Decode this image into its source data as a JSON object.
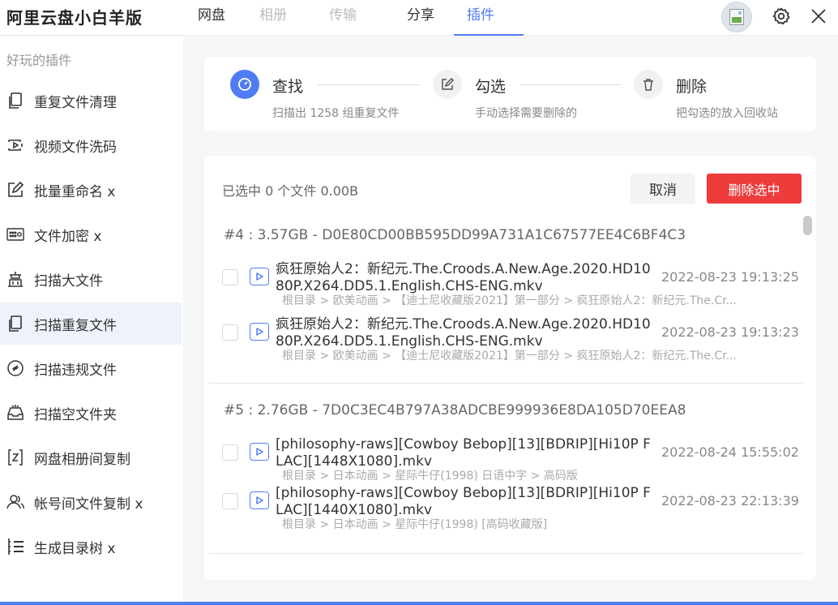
{
  "app": {
    "title": "阿里云盘小白羊版"
  },
  "nav": {
    "tabs": [
      {
        "label": "网盘",
        "state": "normal"
      },
      {
        "label": "相册",
        "state": "dim"
      },
      {
        "label": "传输",
        "state": "dim"
      },
      {
        "label": "分享",
        "state": "normal"
      },
      {
        "label": "插件",
        "state": "active"
      }
    ]
  },
  "sidebar": {
    "heading": "好玩的插件",
    "items": [
      {
        "label": "重复文件清理",
        "icon": "copy-icon"
      },
      {
        "label": "视频文件洗码",
        "icon": "video-icon"
      },
      {
        "label": "批量重命名 x",
        "icon": "edit-icon"
      },
      {
        "label": "文件加密 x",
        "icon": "keypad-icon"
      },
      {
        "label": "扫描大文件",
        "icon": "building-icon"
      },
      {
        "label": "扫描重复文件",
        "icon": "copy-icon",
        "active": true
      },
      {
        "label": "扫描违规文件",
        "icon": "link-icon"
      },
      {
        "label": "扫描空文件夹",
        "icon": "tray-icon"
      },
      {
        "label": "网盘相册间复制",
        "icon": "album-copy-icon"
      },
      {
        "label": "帐号间文件复制 x",
        "icon": "users-icon"
      },
      {
        "label": "生成目录树 x",
        "icon": "tree-icon"
      }
    ]
  },
  "steps": [
    {
      "title": "查找",
      "desc": "扫描出 1258 组重复文件",
      "icon": "timer-icon",
      "active": true
    },
    {
      "title": "勾选",
      "desc": "手动选择需要删除的",
      "icon": "edit-icon",
      "active": false
    },
    {
      "title": "删除",
      "desc": "把勾选的放入回收站",
      "icon": "trash-icon",
      "active": false
    }
  ],
  "list": {
    "selected_info": "已选中 0 个文件 0.00B",
    "cancel_label": "取消",
    "delete_label": "删除选中",
    "groups": [
      {
        "header": "#4 : 3.57GB - D0E80CD00BB595DD99A731A1C67577EE4C6BF4C3",
        "files": [
          {
            "name": "疯狂原始人2：新纪元.The.Croods.A.New.Age.2020.HD1080P.X264.DD5.1.English.CHS-ENG.mkv",
            "date": "2022-08-23 19:13:25",
            "path": "根目录 > 欧美动画 > 【迪士尼收藏版2021】第一部分 > 疯狂原始人2：新纪元.The.Cr..."
          },
          {
            "name": "疯狂原始人2：新纪元.The.Croods.A.New.Age.2020.HD1080P.X264.DD5.1.English.CHS-ENG.mkv",
            "date": "2022-08-23 19:13:23",
            "path": "根目录 > 欧美动画 > 【迪士尼收藏版2021】第一部分 > 疯狂原始人2：新纪元.The.Cr..."
          }
        ]
      },
      {
        "header": "#5 : 2.76GB - 7D0C3EC4B797A38ADCBE999936E8DA105D70EEA8",
        "files": [
          {
            "name": "[philosophy-raws][Cowboy Bebop][13][BDRIP][Hi10P FLAC][1448X1080].mkv",
            "date": "2022-08-24 15:55:02",
            "path": "根目录 > 日本动画 > 星际牛仔(1998) 日语中字 > 高码版"
          },
          {
            "name": "[philosophy-raws][Cowboy Bebop][13][BDRIP][Hi10P FLAC][1440X1080].mkv",
            "date": "2022-08-23 22:13:39",
            "path": "根目录 > 日本动画 > 星际牛仔(1998) [高码收藏版]"
          }
        ]
      }
    ]
  },
  "colors": {
    "accent": "#4f7cf3",
    "danger": "#ee3b3b"
  }
}
